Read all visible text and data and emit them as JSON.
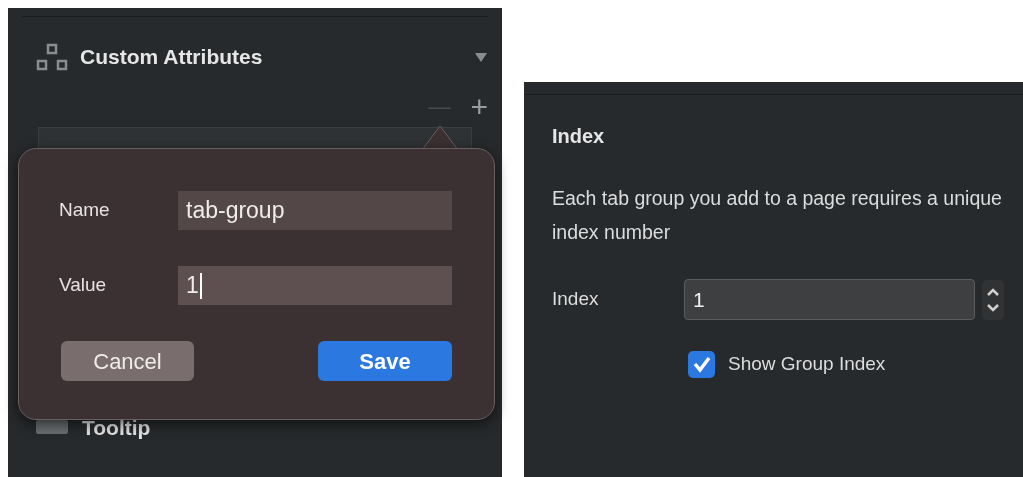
{
  "attributes_panel": {
    "title": "Custom Attributes",
    "expanded": true,
    "remove_button": "—",
    "add_button": "+",
    "next_section": "Tooltip"
  },
  "popover": {
    "fields": [
      {
        "label": "Name",
        "value": "tab-group",
        "focused": false
      },
      {
        "label": "Value",
        "value": "1",
        "focused": true
      }
    ],
    "cancel_button": "Cancel",
    "save_button": "Save"
  },
  "index_panel": {
    "title": "Index",
    "description": "Each tab group you add to a page requires a unique index number",
    "index_label": "Index",
    "index_value": "1",
    "show_group_index": {
      "label": "Show Group Index",
      "checked": true
    }
  }
}
